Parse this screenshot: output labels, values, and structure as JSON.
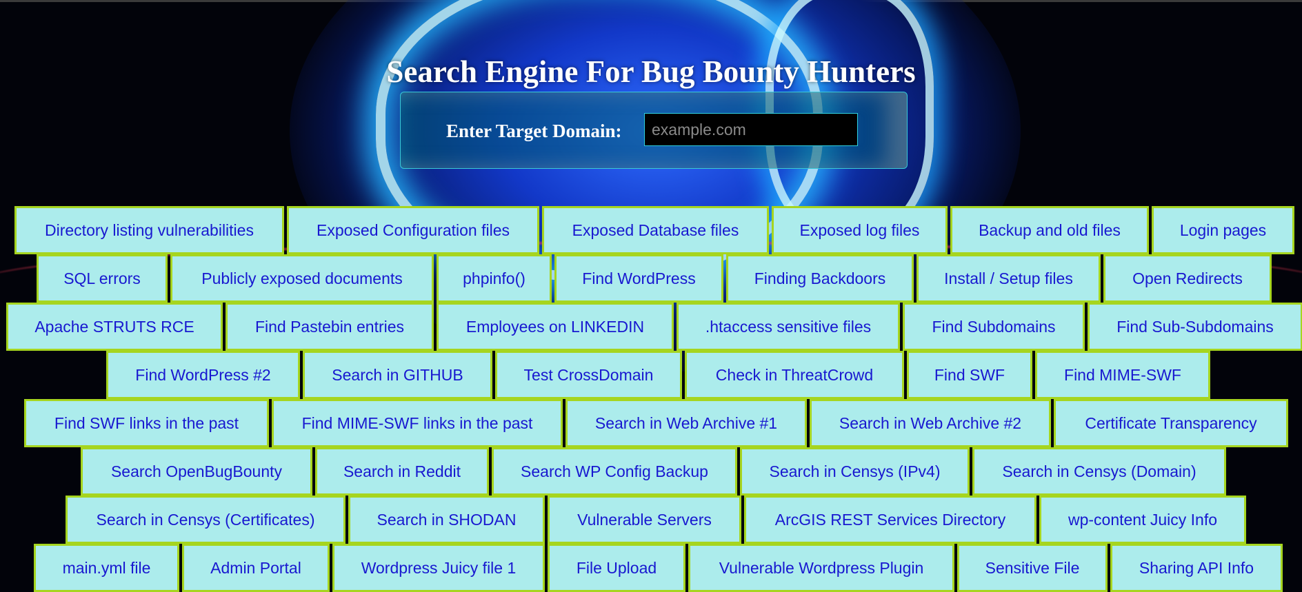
{
  "page": {
    "title": "Search Engine For Bug Bounty Hunters"
  },
  "search": {
    "label": "Enter Target Domain:",
    "placeholder": "example.com",
    "value": ""
  },
  "rows": [
    [
      "Directory listing vulnerabilities",
      "Exposed Configuration files",
      "Exposed Database files",
      "Exposed log files",
      "Backup and old files",
      "Login pages"
    ],
    [
      "SQL errors",
      "Publicly exposed documents",
      "phpinfo()",
      "Find WordPress",
      "Finding Backdoors",
      "Install / Setup files",
      "Open Redirects"
    ],
    [
      "Apache STRUTS RCE",
      "Find Pastebin entries",
      "Employees on LINKEDIN",
      ".htaccess sensitive files",
      "Find Subdomains",
      "Find Sub-Subdomains"
    ],
    [
      "Find WordPress #2",
      "Search in GITHUB",
      "Test CrossDomain",
      "Check in ThreatCrowd",
      "Find SWF",
      "Find MIME-SWF"
    ],
    [
      "Find SWF links in the past",
      "Find MIME-SWF links in the past",
      "Search in Web Archive #1",
      "Search in Web Archive #2",
      "Certificate Transparency"
    ],
    [
      "Search OpenBugBounty",
      "Search in Reddit",
      "Search WP Config Backup",
      "Search in Censys (IPv4)",
      "Search in Censys (Domain)"
    ],
    [
      "Search in Censys (Certificates)",
      "Search in SHODAN",
      "Vulnerable Servers",
      "ArcGIS REST Services Directory",
      "wp-content Juicy Info"
    ],
    [
      "main.yml file",
      "Admin Portal",
      "Wordpress Juicy file 1",
      "File Upload",
      "Vulnerable Wordpress Plugin",
      "Sensitive File",
      "Sharing API Info"
    ]
  ],
  "colors": {
    "button_bg": "#acecec",
    "button_border": "#a6d51f",
    "button_text": "#1818d0",
    "background_glow": "#1238c8"
  }
}
